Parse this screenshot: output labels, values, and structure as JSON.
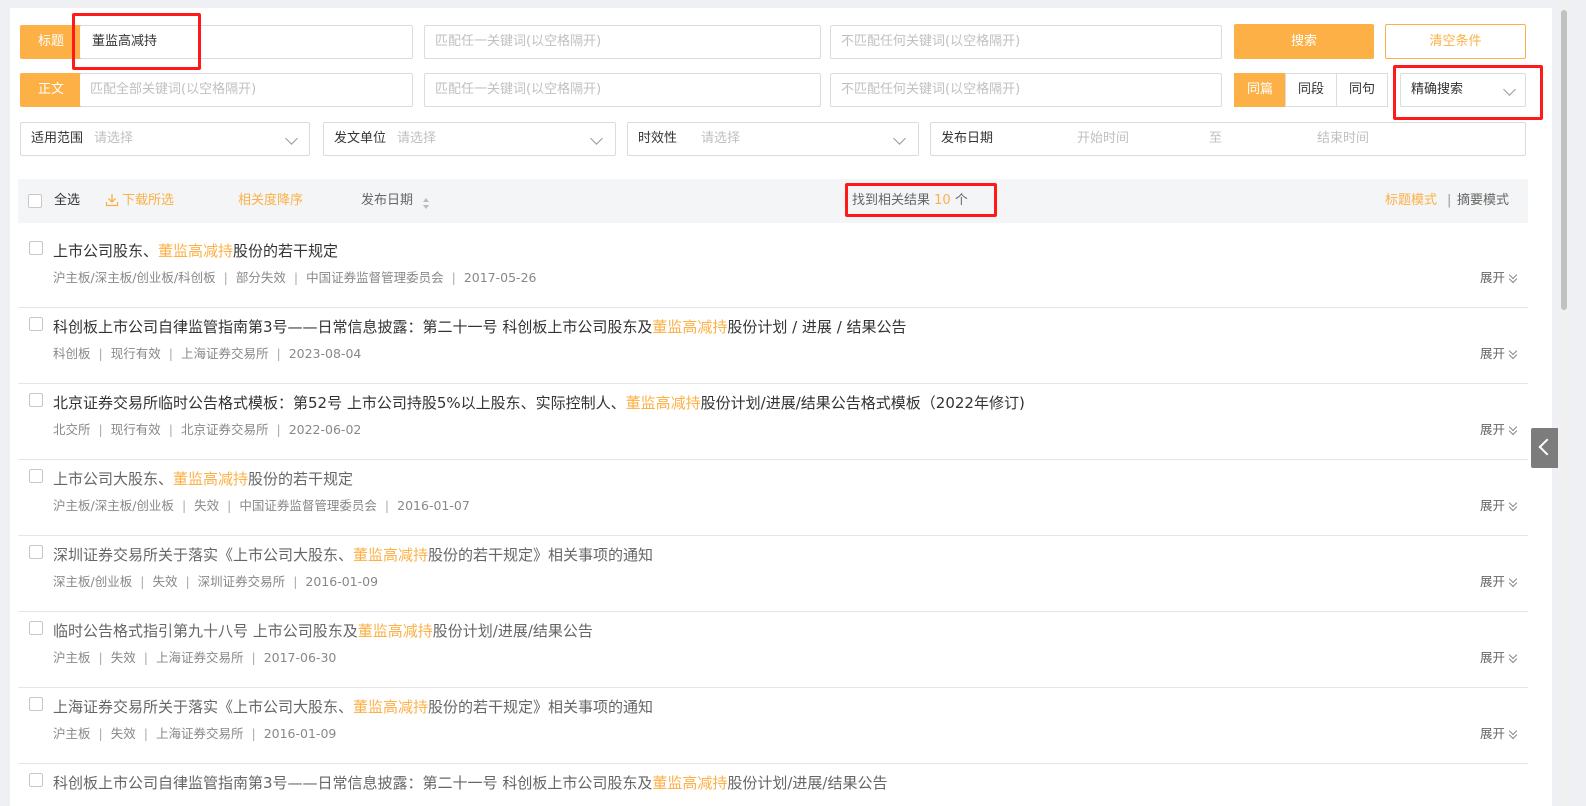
{
  "search": {
    "title_tag": "标题",
    "title_value": "董监高减持",
    "title_any_placeholder": "匹配任一关键词(以空格隔开)",
    "title_none_placeholder": "不匹配任何关键词(以空格隔开)",
    "search_button": "搜索",
    "clear_button": "清空条件",
    "body_tag": "正文",
    "body_all_placeholder": "匹配全部关键词(以空格隔开)",
    "body_any_placeholder": "匹配任一关键词(以空格隔开)",
    "body_none_placeholder": "不匹配任何关键词(以空格隔开)",
    "scope_options": [
      "同篇",
      "同段",
      "同句"
    ],
    "scope_selected": "同篇",
    "mode_select": "精确搜索"
  },
  "filters": {
    "scope_label": "适用范围",
    "scope_placeholder": "请选择",
    "issuer_label": "发文单位",
    "issuer_placeholder": "请选择",
    "validity_label": "时效性",
    "validity_placeholder": "请选择",
    "date_label": "发布日期",
    "date_start_placeholder": "开始时间",
    "date_to": "至",
    "date_end_placeholder": "结束时间"
  },
  "toolbar": {
    "select_all": "全选",
    "download_selected": "下载所选",
    "sort_relevance": "相关度降序",
    "sort_date": "发布日期",
    "result_prefix": "找到相关结果",
    "result_count": "10",
    "result_suffix": "个",
    "mode_title": "标题模式",
    "mode_divider": "|",
    "mode_abstract": "摘要模式"
  },
  "highlight": "董监高减持",
  "expand_label": "展开",
  "results": [
    {
      "pre": "上市公司股东、",
      "post": "股份的若干规定",
      "meta": [
        "沪主板/深主板/创业板/科创板",
        "部分失效",
        "中国证券监督管理委员会",
        "2017-05-26"
      ]
    },
    {
      "pre": "科创板上市公司自律监管指南第3号——日常信息披露：第二十一号 科创板上市公司股东及",
      "post": "股份计划 / 进展 / 结果公告",
      "meta": [
        "科创板",
        "现行有效",
        "上海证券交易所",
        "2023-08-04"
      ]
    },
    {
      "pre": "北京证券交易所临时公告格式模板：第52号 上市公司持股5%以上股东、实际控制人、",
      "post": "股份计划/进展/结果公告格式模板（2022年修订)",
      "meta": [
        "北交所",
        "现行有效",
        "北京证券交易所",
        "2022-06-02"
      ]
    },
    {
      "pre": "上市公司大股东、",
      "post": "股份的若干规定",
      "meta": [
        "沪主板/深主板/创业板",
        "失效",
        "中国证券监督管理委员会",
        "2016-01-07"
      ]
    },
    {
      "pre": "深圳证券交易所关于落实《上市公司大股东、",
      "post": "股份的若干规定》相关事项的通知",
      "meta": [
        "深主板/创业板",
        "失效",
        "深圳证券交易所",
        "2016-01-09"
      ]
    },
    {
      "pre": "临时公告格式指引第九十八号 上市公司股东及",
      "post": "股份计划/进展/结果公告",
      "meta": [
        "沪主板",
        "失效",
        "上海证券交易所",
        "2017-06-30"
      ]
    },
    {
      "pre": "上海证券交易所关于落实《上市公司大股东、",
      "post": "股份的若干规定》相关事项的通知",
      "meta": [
        "沪主板",
        "失效",
        "上海证券交易所",
        "2016-01-09"
      ]
    },
    {
      "pre": "科创板上市公司自律监管指南第3号——日常信息披露：第二十一号 科创板上市公司股东及",
      "post": "股份计划/进展/结果公告",
      "meta": []
    }
  ]
}
